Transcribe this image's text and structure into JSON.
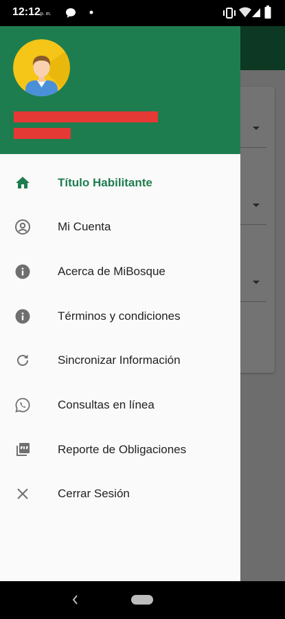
{
  "status_bar": {
    "time": "12:12",
    "ampm": "p. m.",
    "left_icons": [
      "chat-icon",
      "dot-icon"
    ],
    "right_icons": [
      "vibrate-icon",
      "wifi-icon",
      "signal-icon",
      "battery-icon"
    ]
  },
  "drawer": {
    "avatar_icon": "user-avatar-icon",
    "menu": [
      {
        "label": "Título Habilitante",
        "icon": "home-icon",
        "active": true
      },
      {
        "label": "Mi Cuenta",
        "icon": "account-circle-icon",
        "active": false
      },
      {
        "label": "Acerca de MiBosque",
        "icon": "info-icon",
        "active": false
      },
      {
        "label": "Términos y condiciones",
        "icon": "info-icon",
        "active": false
      },
      {
        "label": "Sincronizar Información",
        "icon": "refresh-icon",
        "active": false
      },
      {
        "label": "Consultas en línea",
        "icon": "whatsapp-icon",
        "active": false
      },
      {
        "label": "Reporte de Obligaciones",
        "icon": "pdf-icon",
        "active": false
      },
      {
        "label": "Cerrar Sesión",
        "icon": "close-icon",
        "active": false
      }
    ]
  },
  "colors": {
    "brand_green": "#1e7d4f",
    "redaction_red": "#e53935",
    "icon_gray": "#6f6f6f"
  },
  "navigation_bar": {
    "icons": [
      "back-icon",
      "home-pill-icon"
    ]
  }
}
